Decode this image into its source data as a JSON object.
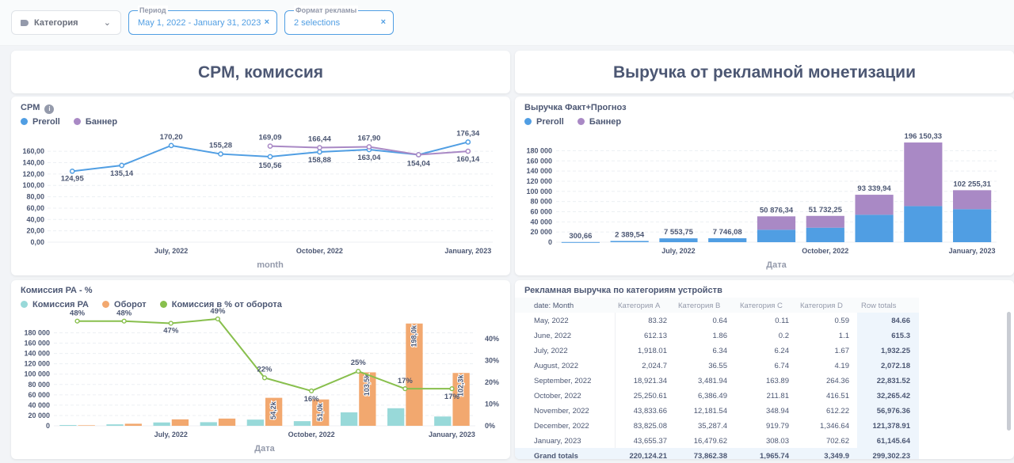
{
  "filters": {
    "category": {
      "label": "Категория",
      "icon": "tag-icon"
    },
    "period": {
      "label": "Период",
      "value": "May 1, 2022 - January 31, 2023"
    },
    "ad_format": {
      "label": "Формат рекламы",
      "value": "2 selections"
    },
    "clear_symbol": "×",
    "chevron_symbol": "⌄"
  },
  "sections": {
    "left_heading": "CPM, комиссия",
    "right_heading": "Выручка от рекламной монетизации"
  },
  "cpm_card": {
    "title": "CPM",
    "info_symbol": "i",
    "legend": [
      {
        "name": "Preroll",
        "color": "#509ee3"
      },
      {
        "name": "Баннер",
        "color": "#a989c5"
      }
    ],
    "xlabel": "month"
  },
  "revenue_card": {
    "title": "Выручка Факт+Прогноз",
    "legend": [
      {
        "name": "Preroll",
        "color": "#509ee3"
      },
      {
        "name": "Баннер",
        "color": "#a989c5"
      }
    ],
    "xlabel": "Дата"
  },
  "commission_card": {
    "title": "Комиссия РА - %",
    "legend": [
      {
        "name": "Комиссия РА",
        "color": "#98d9d9"
      },
      {
        "name": "Оборот",
        "color": "#f2a86f"
      },
      {
        "name": "Комиссия в % от оборота",
        "color": "#88bf4d"
      }
    ],
    "xlabel": "Дата"
  },
  "table_card": {
    "title": "Рекламная выручка по категориям устройств",
    "columns": [
      "date: Month",
      "Категория A",
      "Категория B",
      "Категория C",
      "Категория D",
      "Row totals"
    ],
    "rows": [
      [
        "May, 2022",
        "83.32",
        "0.64",
        "0.11",
        "0.59",
        "84.66"
      ],
      [
        "June, 2022",
        "612.13",
        "1.86",
        "0.2",
        "1.1",
        "615.3"
      ],
      [
        "July, 2022",
        "1,918.01",
        "6.34",
        "6.24",
        "1.67",
        "1,932.25"
      ],
      [
        "August, 2022",
        "2,024.7",
        "36.55",
        "6.74",
        "4.19",
        "2,072.18"
      ],
      [
        "September, 2022",
        "18,921.34",
        "3,481.94",
        "163.89",
        "264.36",
        "22,831.52"
      ],
      [
        "October, 2022",
        "25,250.61",
        "6,386.49",
        "211.81",
        "416.51",
        "32,265.42"
      ],
      [
        "November, 2022",
        "43,833.66",
        "12,181.54",
        "348.94",
        "612.22",
        "56,976.36"
      ],
      [
        "December, 2022",
        "83,825.08",
        "35,287.4",
        "919.79",
        "1,346.64",
        "121,378.91"
      ],
      [
        "January, 2023",
        "43,655.37",
        "16,479.62",
        "308.03",
        "702.62",
        "61,145.64"
      ],
      [
        "Grand totals",
        "220,124.21",
        "73,862.38",
        "1,965.74",
        "3,349.9",
        "299,302.23"
      ]
    ]
  },
  "chart_data": [
    {
      "type": "line",
      "title": "CPM",
      "xlabel": "month",
      "ylim": [
        0,
        170
      ],
      "yticks": [
        "0,00",
        "20,00",
        "40,00",
        "60,00",
        "80,00",
        "100,00",
        "120,00",
        "140,00",
        "160,00"
      ],
      "x": [
        "May, 2022",
        "June, 2022",
        "July, 2022",
        "August, 2022",
        "September, 2022",
        "October, 2022",
        "November, 2022",
        "December, 2022",
        "January, 2023"
      ],
      "xticks": [
        {
          "index": 2,
          "label": "July, 2022"
        },
        {
          "index": 5,
          "label": "October, 2022"
        },
        {
          "index": 8,
          "label": "January, 2023"
        }
      ],
      "series": [
        {
          "name": "Preroll",
          "color": "#509ee3",
          "values": [
            124.95,
            135.14,
            170.2,
            155.28,
            150.56,
            158.88,
            163.04,
            154.04,
            176.34
          ],
          "labels": [
            "124,95",
            "135,14",
            "170,20",
            "155,28",
            "150,56",
            "158,88",
            "163,04",
            "154,04",
            "176,34"
          ]
        },
        {
          "name": "Баннер",
          "color": "#a989c5",
          "values": [
            null,
            null,
            null,
            null,
            169.09,
            166.44,
            167.9,
            154.04,
            160.14
          ],
          "labels": [
            "",
            "",
            "",
            "",
            "169,09",
            "166,44",
            "167,90",
            "",
            "160,14"
          ]
        }
      ]
    },
    {
      "type": "bar",
      "stacked": true,
      "title": "Выручка Факт+Прогноз",
      "xlabel": "Дата",
      "ylim": [
        0,
        190000
      ],
      "yticks": [
        "0",
        "20 000",
        "40 000",
        "60 000",
        "80 000",
        "100 000",
        "120 000",
        "140 000",
        "160 000",
        "180 000"
      ],
      "categories": [
        "May, 2022",
        "June, 2022",
        "July, 2022",
        "August, 2022",
        "September, 2022",
        "October, 2022",
        "November, 2022",
        "December, 2022",
        "January, 2023"
      ],
      "xticks": [
        {
          "index": 2,
          "label": "July, 2022"
        },
        {
          "index": 5,
          "label": "October, 2022"
        },
        {
          "index": 8,
          "label": "January, 2023"
        }
      ],
      "series": [
        {
          "name": "Preroll",
          "color": "#509ee3",
          "values": [
            300.66,
            2389.54,
            7553.75,
            7746.08,
            24500,
            28500,
            54000,
            71000,
            65000
          ]
        },
        {
          "name": "Баннер",
          "color": "#a989c5",
          "values": [
            0,
            0,
            0,
            0,
            26376.34,
            23232.25,
            39339.94,
            125150.33,
            37255.31
          ]
        }
      ],
      "totals": [
        "300,66",
        "2 389,54",
        "7 553,75",
        "7 746,08",
        "50 876,34",
        "51 732,25",
        "93 339,94",
        "196 150,33",
        "102 255,31"
      ]
    },
    {
      "type": "bar",
      "title": "Комиссия РА - %",
      "xlabel": "Дата",
      "ylim": [
        0,
        190000
      ],
      "yticks": [
        "0",
        "20 000",
        "40 000",
        "60 000",
        "80 000",
        "100 000",
        "120 000",
        "140 000",
        "160 000",
        "180 000"
      ],
      "y2ticks": [
        "0%",
        "10%",
        "20%",
        "30%",
        "40%"
      ],
      "y2lim": [
        0,
        0.45
      ],
      "categories": [
        "May, 2022",
        "June, 2022",
        "July, 2022",
        "August, 2022",
        "September, 2022",
        "October, 2022",
        "November, 2022",
        "December, 2022",
        "January, 2023"
      ],
      "xticks": [
        {
          "index": 2,
          "label": "July, 2022"
        },
        {
          "index": 5,
          "label": "October, 2022"
        },
        {
          "index": 8,
          "label": "January, 2023"
        }
      ],
      "series": [
        {
          "name": "Комиссия РА",
          "color": "#98d9d9",
          "values": [
            1500,
            2800,
            6500,
            7000,
            12000,
            9000,
            26000,
            34000,
            18000
          ]
        },
        {
          "name": "Оборот",
          "color": "#f2a86f",
          "values": [
            1000,
            4000,
            12500,
            14000,
            54200,
            51000,
            103500,
            198000,
            102300
          ],
          "labels": [
            "",
            "",
            "",
            "",
            "54,2k",
            "51,0k",
            "103,5k",
            "198,0k",
            "102,3k"
          ]
        },
        {
          "name": "Комиссия в % от оборота",
          "color": "#88bf4d",
          "axis": "right",
          "values": [
            0.48,
            0.48,
            0.47,
            0.49,
            0.22,
            0.16,
            0.25,
            0.17,
            0.17
          ],
          "labels": [
            "48%",
            "48%",
            "47%",
            "49%",
            "22%",
            "16%",
            "25%",
            "17%",
            "17%"
          ]
        }
      ]
    }
  ]
}
